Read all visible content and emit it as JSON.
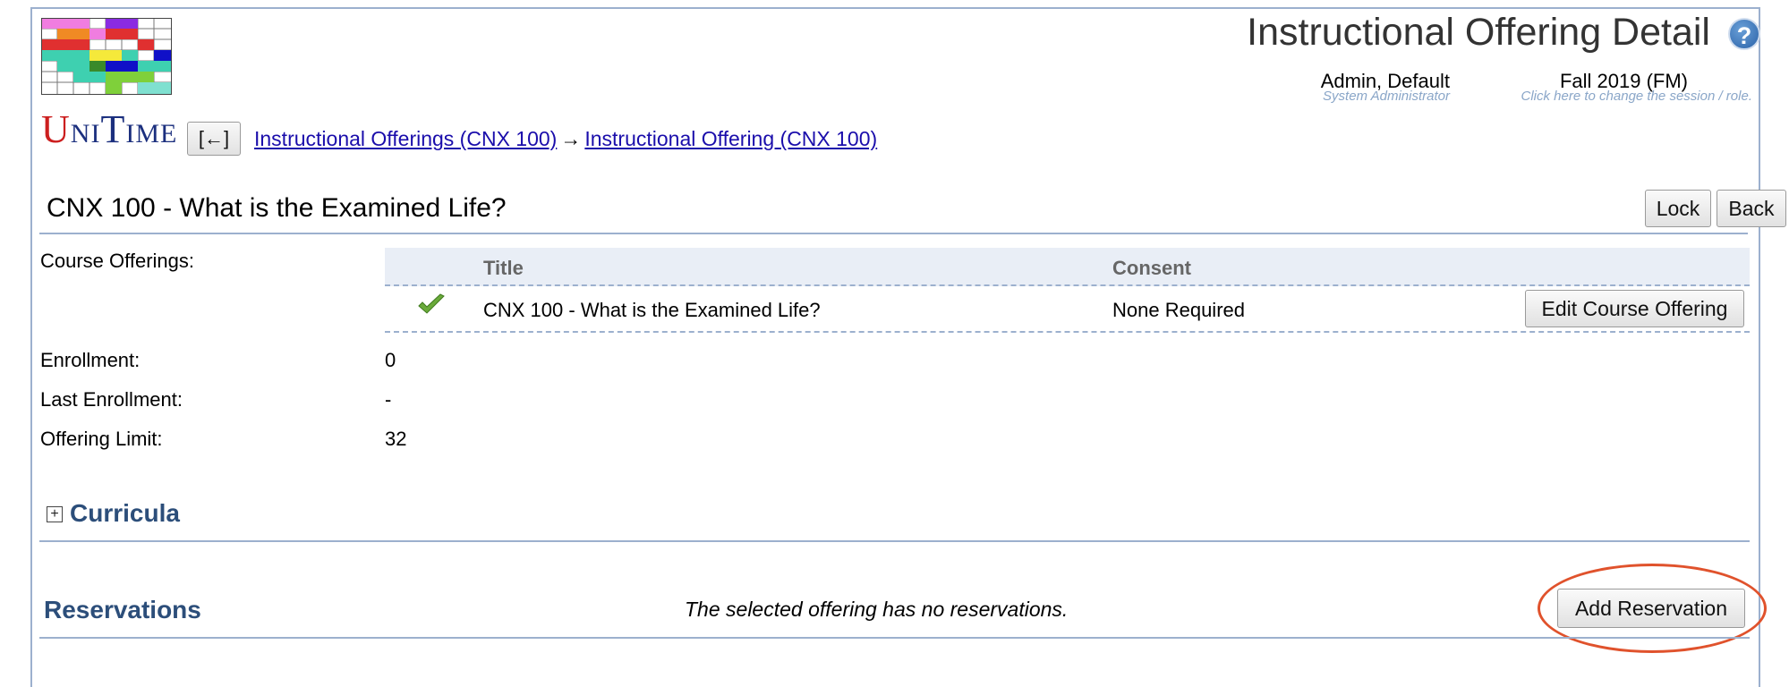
{
  "app": {
    "logo_text": "UniTime",
    "page_title": "Instructional Offering Detail"
  },
  "user": {
    "name": "Admin, Default",
    "role": "System Administrator"
  },
  "session": {
    "name": "Fall 2019 (FM)",
    "hint": "Click here to change the session / role."
  },
  "nav": {
    "back_label": "[←]",
    "breadcrumb": [
      {
        "label": "Instructional Offerings (CNX 100)"
      },
      {
        "label": "Instructional Offering (CNX 100)"
      }
    ],
    "separator": "→"
  },
  "offering": {
    "title": "CNX 100 - What is the Examined Life?",
    "lock_label": "Lock",
    "back_label": "Back"
  },
  "details": {
    "course_offerings_label": "Course Offerings:",
    "course_table": {
      "headers": [
        "Title",
        "Consent"
      ],
      "rows": [
        {
          "title": "CNX 100 - What is the Examined Life?",
          "consent": "None Required",
          "action": "Edit Course Offering",
          "icon": "check-icon"
        }
      ]
    },
    "enrollment_label": "Enrollment:",
    "enrollment_value": "0",
    "last_enrollment_label": "Last Enrollment:",
    "last_enrollment_value": "-",
    "offering_limit_label": "Offering Limit:",
    "offering_limit_value": "32"
  },
  "curricula": {
    "title": "Curricula",
    "expand_symbol": "+"
  },
  "reservations": {
    "title": "Reservations",
    "empty_message": "The selected offering has no reservations.",
    "add_button_label": "Add Reservation"
  },
  "colors": {
    "accent_line": "#9cb0ce",
    "section_title": "#2c4e7a",
    "link": "#1a0dab",
    "highlight": "#e0522c"
  }
}
